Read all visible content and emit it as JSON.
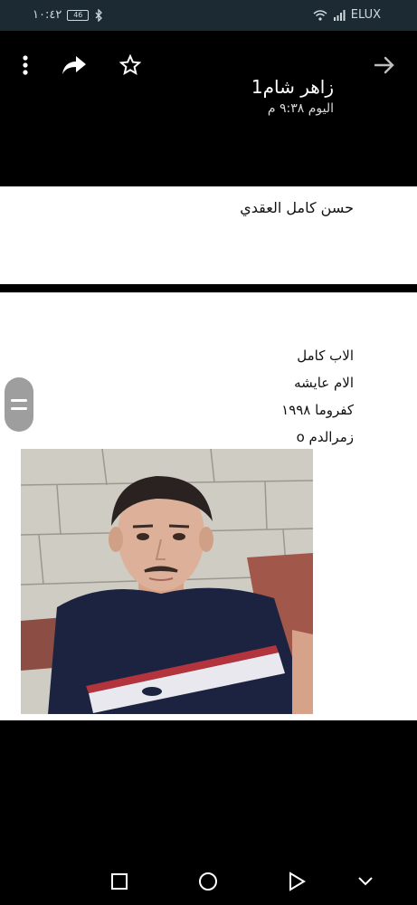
{
  "status_bar": {
    "time": "١٠:٤٢",
    "battery": "46",
    "carrier": "ELUX"
  },
  "header": {
    "title": "زاهر شام1",
    "subtitle": "اليوم ٩:٣٨ م"
  },
  "message1": {
    "name": "حسن كامل العقدي"
  },
  "message2": {
    "lines": [
      "الاب كامل",
      "الام عايشه",
      "كفروما ١٩٩٨",
      "زمرالدم o"
    ]
  },
  "icons": {
    "back": "arrow-right-icon",
    "star": "star-icon",
    "share": "share-icon",
    "menu": "more-vert-icon"
  },
  "colors": {
    "status_bar_bg": "#1c2a33",
    "topbar_bg": "#000000",
    "shirt": "#1b2340"
  }
}
